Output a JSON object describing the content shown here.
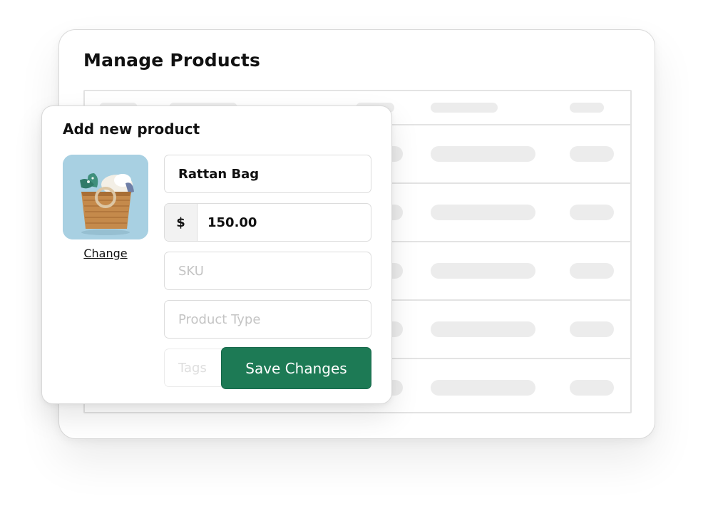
{
  "manage": {
    "title": "Manage Products"
  },
  "form": {
    "title": "Add new product",
    "change_label": "Change",
    "name_value": "Rattan Bag",
    "currency_symbol": "$",
    "price_value": "150.00",
    "sku_placeholder": "SKU",
    "type_placeholder": "Product Type",
    "tags_placeholder": "Tags",
    "save_label": "Save Changes"
  },
  "colors": {
    "primary": "#1d7a55",
    "placeholder_bar": "#ececec",
    "border": "#dcdcdc"
  },
  "icons": {
    "product_image": "basket-photo"
  }
}
